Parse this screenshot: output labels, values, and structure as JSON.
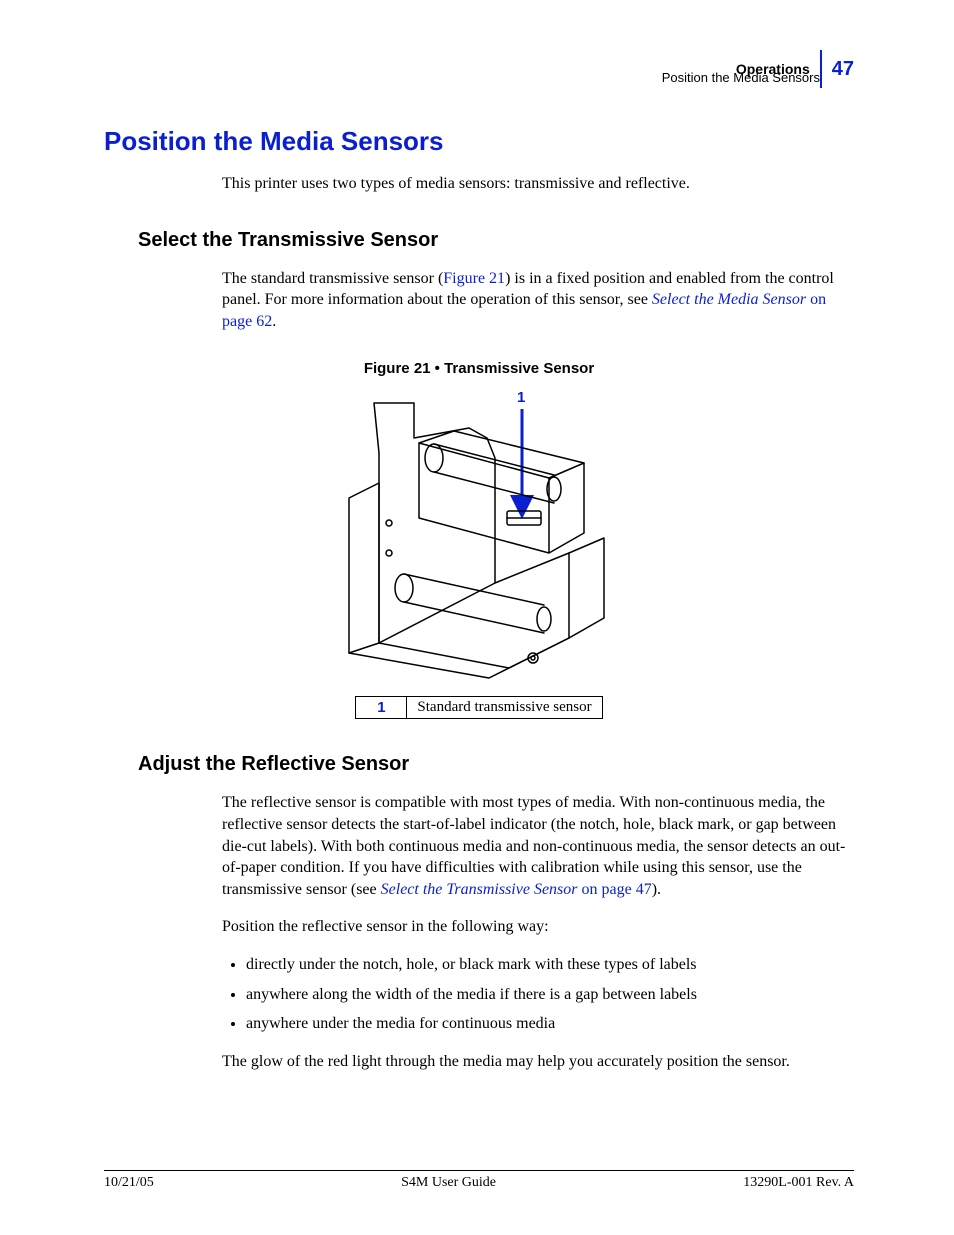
{
  "header": {
    "chapter": "Operations",
    "section": "Position the Media Sensors",
    "page_number": "47"
  },
  "title": "Position the Media Sensors",
  "intro": "This printer uses two types of media sensors: transmissive and reflective.",
  "section1": {
    "heading": "Select the Transmissive Sensor",
    "para_part1": "The standard transmissive sensor (",
    "fig_ref": "Figure 21",
    "para_part2": ") is in a fixed position and enabled from the control panel. For more information about the operation of this sensor, see ",
    "link_text": "Select the Media Sensor",
    "link_page": " on page 62",
    "para_end": "."
  },
  "figure": {
    "caption": "Figure 21 • Transmissive Sensor",
    "callout": "1",
    "legend_num": "1",
    "legend_text": "Standard transmissive sensor"
  },
  "section2": {
    "heading": "Adjust the Reflective Sensor",
    "para1_a": "The reflective sensor is compatible with most types of media. With non-continuous media, the reflective sensor detects the start-of-label indicator (the notch, hole, black mark, or gap between die-cut labels). With both continuous media and non-continuous media, the sensor detects an out-of-paper condition. If you have difficulties with calibration while using this sensor, use the transmissive sensor (see ",
    "link_text": "Select the Transmissive Sensor",
    "link_page": " on page 47",
    "para1_b": ").",
    "para2": "Position the reflective sensor in the following way:",
    "bullets": [
      "directly under the notch, hole, or black mark with these types of labels",
      "anywhere along the width of the media if there is a gap between labels",
      "anywhere under the media for continuous media"
    ],
    "para3": "The glow of the red light through the media may help you accurately position the sensor."
  },
  "footer": {
    "left": "10/21/05",
    "center": "S4M User Guide",
    "right": "13290L-001 Rev. A"
  }
}
